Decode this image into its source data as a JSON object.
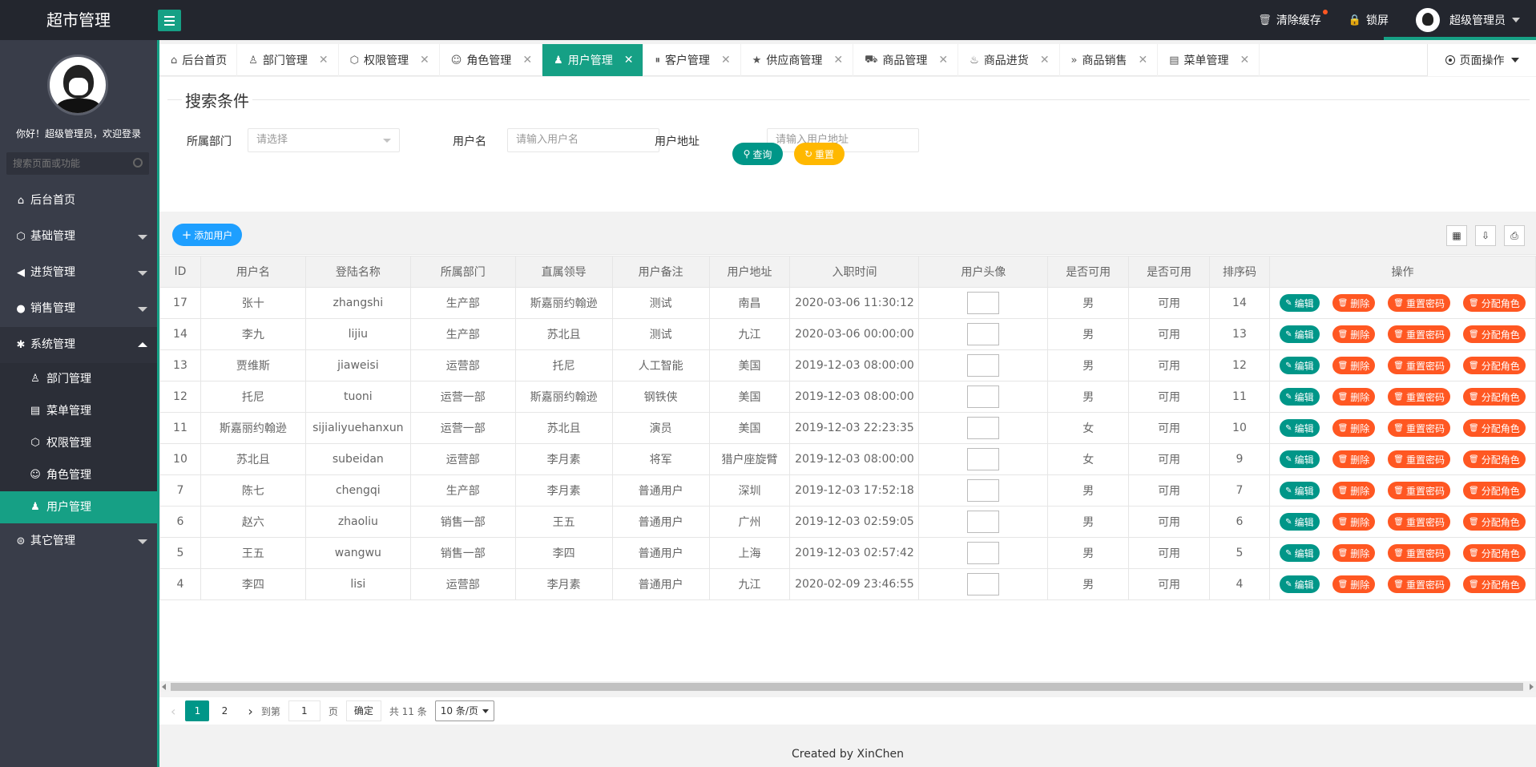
{
  "app": {
    "title": "超市管理"
  },
  "header": {
    "clear_cache": "清除缓存",
    "lock_screen": "锁屏",
    "user_name": "超级管理员"
  },
  "sidebar": {
    "welcome": "你好！超级管理员，欢迎登录",
    "search_placeholder": "搜索页面或功能",
    "items": [
      {
        "label": "后台首页",
        "icon": "home-icon"
      },
      {
        "label": "基础管理",
        "icon": "cube-icon"
      },
      {
        "label": "进货管理",
        "icon": "speaker-icon"
      },
      {
        "label": "销售管理",
        "icon": "chat-icon"
      },
      {
        "label": "系统管理",
        "icon": "gear-icon"
      }
    ],
    "sub_items": [
      {
        "label": "部门管理",
        "icon": "user-outline-icon"
      },
      {
        "label": "菜单管理",
        "icon": "menu-icon"
      },
      {
        "label": "权限管理",
        "icon": "cube-icon"
      },
      {
        "label": "角色管理",
        "icon": "smile-icon"
      },
      {
        "label": "用户管理",
        "icon": "user-icon"
      }
    ],
    "other": {
      "label": "其它管理",
      "icon": "other-icon"
    }
  },
  "tabs": [
    {
      "label": "后台首页",
      "icon": "home-icon",
      "closable": false
    },
    {
      "label": "部门管理",
      "icon": "user-outline-icon",
      "closable": true
    },
    {
      "label": "权限管理",
      "icon": "cube-icon",
      "closable": true
    },
    {
      "label": "角色管理",
      "icon": "smile-icon",
      "closable": true
    },
    {
      "label": "用户管理",
      "icon": "user-icon",
      "closable": true,
      "active": true
    },
    {
      "label": "客户管理",
      "icon": "pause-icon",
      "closable": true
    },
    {
      "label": "供应商管理",
      "icon": "star-icon",
      "closable": true
    },
    {
      "label": "商品管理",
      "icon": "cart-icon",
      "closable": true
    },
    {
      "label": "商品进货",
      "icon": "fire-icon",
      "closable": true
    },
    {
      "label": "商品销售",
      "icon": "double-chevron-icon",
      "closable": true
    },
    {
      "label": "菜单管理",
      "icon": "menu-icon",
      "closable": true
    }
  ],
  "page_ops": "页面操作",
  "search": {
    "title": "搜索条件",
    "dept_label": "所属部门",
    "dept_placeholder": "请选择",
    "username_label": "用户名",
    "username_placeholder": "请输入用户名",
    "address_label": "用户地址",
    "address_placeholder": "请输入用户地址",
    "query_btn": "查询",
    "reset_btn": "重置"
  },
  "toolbar": {
    "add_btn": "添加用户"
  },
  "table": {
    "columns": [
      "ID",
      "用户名",
      "登陆名称",
      "所属部门",
      "直属领导",
      "用户备注",
      "用户地址",
      "入职时间",
      "用户头像",
      "是否可用",
      "是否可用",
      "排序码",
      "操作"
    ],
    "rows": [
      [
        "17",
        "张十",
        "zhangshi",
        "生产部",
        "斯嘉丽约翰逊",
        "测试",
        "南昌",
        "2020-03-06 11:30:12",
        "男",
        "可用",
        "14"
      ],
      [
        "14",
        "李九",
        "lijiu",
        "生产部",
        "苏北且",
        "测试",
        "九江",
        "2020-03-06 00:00:00",
        "男",
        "可用",
        "13"
      ],
      [
        "13",
        "贾维斯",
        "jiaweisi",
        "运营部",
        "托尼",
        "人工智能",
        "美国",
        "2019-12-03 08:00:00",
        "男",
        "可用",
        "12"
      ],
      [
        "12",
        "托尼",
        "tuoni",
        "运营一部",
        "斯嘉丽约翰逊",
        "钢铁侠",
        "美国",
        "2019-12-03 08:00:00",
        "男",
        "可用",
        "11"
      ],
      [
        "11",
        "斯嘉丽约翰逊",
        "sijialiyuehanxun",
        "运营一部",
        "苏北且",
        "演员",
        "美国",
        "2019-12-03 22:23:35",
        "女",
        "可用",
        "10"
      ],
      [
        "10",
        "苏北且",
        "subeidan",
        "运营部",
        "李月素",
        "将军",
        "猎户座旋臂",
        "2019-12-03 08:00:00",
        "女",
        "可用",
        "9"
      ],
      [
        "7",
        "陈七",
        "chengqi",
        "生产部",
        "李月素",
        "普通用户",
        "深圳",
        "2019-12-03 17:52:18",
        "男",
        "可用",
        "7"
      ],
      [
        "6",
        "赵六",
        "zhaoliu",
        "销售一部",
        "王五",
        "普通用户",
        "广州",
        "2019-12-03 02:59:05",
        "男",
        "可用",
        "6"
      ],
      [
        "5",
        "王五",
        "wangwu",
        "销售一部",
        "李四",
        "普通用户",
        "上海",
        "2019-12-03 02:57:42",
        "男",
        "可用",
        "5"
      ],
      [
        "4",
        "李四",
        "lisi",
        "运营部",
        "李月素",
        "普通用户",
        "九江",
        "2020-02-09 23:46:55",
        "男",
        "可用",
        "4"
      ]
    ],
    "ops": [
      "编辑",
      "删除",
      "重置密码",
      "分配角色"
    ]
  },
  "pager": {
    "pages": [
      "1",
      "2"
    ],
    "goto_label": "到第",
    "current": "1",
    "page_unit": "页",
    "confirm": "确定",
    "total": "共 11 条",
    "page_size": "10 条/页"
  },
  "footer": "Created by XinChen",
  "colors": {
    "accent": "#16a085",
    "sidebar": "#393d49",
    "topbar": "#23262e",
    "blue": "#1e9fff",
    "orange": "#ff5722",
    "yellow": "#ffb800"
  }
}
